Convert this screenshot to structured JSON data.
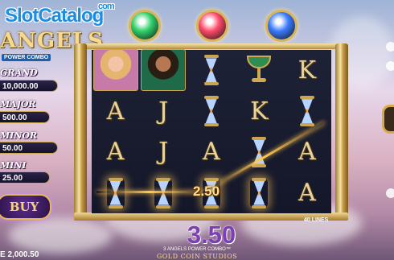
{
  "watermark": {
    "text": "SlotCatalog",
    "suffix": "com"
  },
  "logo": {
    "title": "ANGELS",
    "subtitle": "POWER COMBO"
  },
  "gems": [
    {
      "name": "green-gem",
      "color": "#2fd06a"
    },
    {
      "name": "red-gem",
      "color": "#ff4a6a"
    },
    {
      "name": "blue-gem",
      "color": "#3a7bff"
    }
  ],
  "jackpots": [
    {
      "label": "GRAND",
      "value": "10,000.00"
    },
    {
      "label": "MAJOR",
      "value": "500.00"
    },
    {
      "label": "MINOR",
      "value": "50.00"
    },
    {
      "label": "MINI",
      "value": "25.00"
    }
  ],
  "buy_button": {
    "label": "BUY"
  },
  "reels": [
    [
      "angel-blonde",
      "A",
      "A",
      "hourglass"
    ],
    [
      "angel-dark",
      "J",
      "J",
      "hourglass"
    ],
    [
      "hourglass",
      "hourglass",
      "A",
      "hourglass"
    ],
    [
      "chalice",
      "K",
      "hourglass",
      "hourglass"
    ],
    [
      "K",
      "hourglass",
      "A",
      "A"
    ]
  ],
  "cell_win": "2.50",
  "lines_label": "40 LINES",
  "total_win": "3.50",
  "game_name": "3 ANGELS POWER COMBO™",
  "studio": "GOLD COIN STUDIOS",
  "balance": "E 2,000.50"
}
